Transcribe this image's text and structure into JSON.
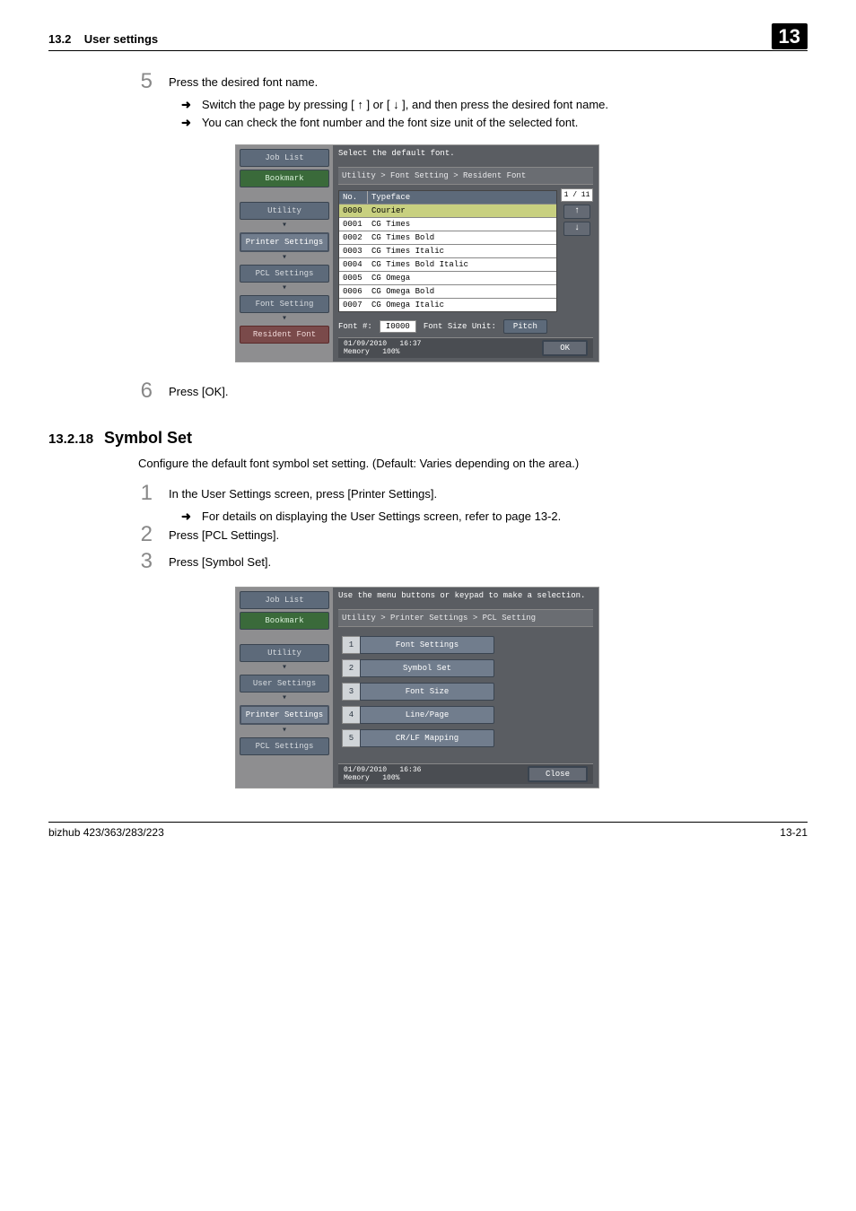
{
  "header": {
    "section_num": "13.2",
    "section_title": "User settings",
    "chapter": "13"
  },
  "step5": {
    "num": "5",
    "text": "Press the desired font name.",
    "bullets": [
      "Switch the page by pressing [ ↑ ] or [ ↓ ], and then press the desired font name.",
      "You can check the font number and the font size unit of the selected font."
    ]
  },
  "screenshot1": {
    "left_tabs": {
      "job_list": "Job List",
      "bookmark": "Bookmark",
      "utility": "Utility",
      "printer_settings": "Printer Settings",
      "pcl_settings": "PCL Settings",
      "font_setting": "Font Setting",
      "resident_font": "Resident Font"
    },
    "prompt": "Select the default font.",
    "breadcrumb": "Utility > Font Setting > Resident Font",
    "cols": {
      "no": "No.",
      "typeface": "Typeface"
    },
    "rows": [
      {
        "no": "0000",
        "tf": "Courier",
        "sel": true
      },
      {
        "no": "0001",
        "tf": "CG Times",
        "sel": false
      },
      {
        "no": "0002",
        "tf": "CG Times Bold",
        "sel": false
      },
      {
        "no": "0003",
        "tf": "CG Times Italic",
        "sel": false
      },
      {
        "no": "0004",
        "tf": "CG Times Bold Italic",
        "sel": false
      },
      {
        "no": "0005",
        "tf": "CG Omega",
        "sel": false
      },
      {
        "no": "0006",
        "tf": "CG Omega Bold",
        "sel": false
      },
      {
        "no": "0007",
        "tf": "CG Omega Italic",
        "sel": false
      }
    ],
    "page_ind": "1 / 11",
    "foot": {
      "font_no_label": "Font #:",
      "font_no_value": "I0000",
      "font_size_label": "Font Size Unit:",
      "font_size_value": "Pitch"
    },
    "status_date": "01/09/2010",
    "status_time": "16:37",
    "status_mem_label": "Memory",
    "status_mem_val": "100%",
    "ok": "OK"
  },
  "step6": {
    "num": "6",
    "text": "Press [OK]."
  },
  "section_13_2_18": {
    "num": "13.2.18",
    "title": "Symbol Set",
    "desc": "Configure the default font symbol set setting. (Default: Varies depending on the area.)"
  },
  "step1": {
    "num": "1",
    "text": "In the User Settings screen, press [Printer Settings].",
    "bullet": "For details on displaying the User Settings screen, refer to page 13-2."
  },
  "step2": {
    "num": "2",
    "text": "Press [PCL Settings]."
  },
  "step3": {
    "num": "3",
    "text": "Press [Symbol Set]."
  },
  "screenshot2": {
    "left_tabs": {
      "job_list": "Job List",
      "bookmark": "Bookmark",
      "utility": "Utility",
      "user_settings": "User Settings",
      "printer_settings": "Printer Settings",
      "pcl_settings": "PCL Settings"
    },
    "prompt": "Use the menu buttons or keypad to make a selection.",
    "breadcrumb": "Utility > Printer Settings > PCL Setting",
    "menu": [
      {
        "n": "1",
        "label": "Font Settings"
      },
      {
        "n": "2",
        "label": "Symbol Set"
      },
      {
        "n": "3",
        "label": "Font Size"
      },
      {
        "n": "4",
        "label": "Line/Page"
      },
      {
        "n": "5",
        "label": "CR/LF Mapping"
      }
    ],
    "status_date": "01/09/2010",
    "status_time": "16:36",
    "status_mem_label": "Memory",
    "status_mem_val": "100%",
    "close": "Close"
  },
  "footer": {
    "left": "bizhub 423/363/283/223",
    "right": "13-21"
  },
  "arrow_glyph": "➜"
}
